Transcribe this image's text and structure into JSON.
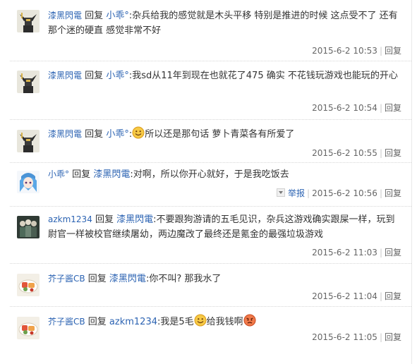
{
  "comments": [
    {
      "user": "漆黑閃電",
      "reply_word": "回复",
      "target": "小乖°",
      "sep": ":",
      "text": "杂兵给我的感觉就是木头平移 特别是推进的时候 这点受不了 还有那个迷的硬直 感觉非常不好",
      "time": "2015-6-2 10:53",
      "reply_label": "回复",
      "avatar": "gundam-avatar"
    },
    {
      "user": "漆黑閃電",
      "reply_word": "回复",
      "target": "小乖°",
      "sep": ":",
      "text": "我sd从11年到现在也就花了475 确实 不花钱玩游戏也能玩的开心",
      "time": "2015-6-2 10:54",
      "reply_label": "回复",
      "avatar": "gundam-avatar"
    },
    {
      "user": "漆黑閃電",
      "reply_word": "回复",
      "target": "小乖°",
      "sep": ":",
      "text": "所以还是那句话 萝卜青菜各有所爱了",
      "time": "2015-6-2 10:55",
      "reply_label": "回复",
      "avatar": "gundam-avatar",
      "emoji": "smile-emoji"
    },
    {
      "user": "小乖°",
      "reply_word": "回复",
      "target": "漆黑閃電",
      "sep": ":",
      "text": "对啊，所以你开心就好，于是我吃饭去",
      "report_label": "举报",
      "time": "2015-6-2 10:56",
      "reply_label": "回复",
      "avatar": "anime-girl-avatar"
    },
    {
      "user": "azkm1234",
      "reply_word": "回复",
      "target": "漆黑閃電",
      "sep": ":",
      "text": "不要跟狗游请的五毛见识，杂兵这游戏确实跟屎一样，玩到尉官一样被校官继续屠幼，两边魔改了最终还是氪金的最强垃圾游戏",
      "time": "2015-6-2 11:03",
      "reply_label": "回复",
      "avatar": "group-avatar"
    },
    {
      "user": "芥子酱CB",
      "reply_word": "回复",
      "target": "漆黑閃電",
      "sep": ":",
      "text": "你不叫? 那我水了",
      "time": "2015-6-2 11:04",
      "reply_label": "回复",
      "avatar": "food-avatar"
    },
    {
      "user": "芥子酱CB",
      "reply_word": "回复",
      "target": "azkm1234",
      "sep": ":",
      "text_a": "我是5毛",
      "text_b": "给我钱啊",
      "time": "2015-6-2 11:05",
      "reply_label": "回复",
      "avatar": "food-avatar",
      "emojis": [
        "smile-emoji",
        "angry-emoji"
      ]
    }
  ]
}
